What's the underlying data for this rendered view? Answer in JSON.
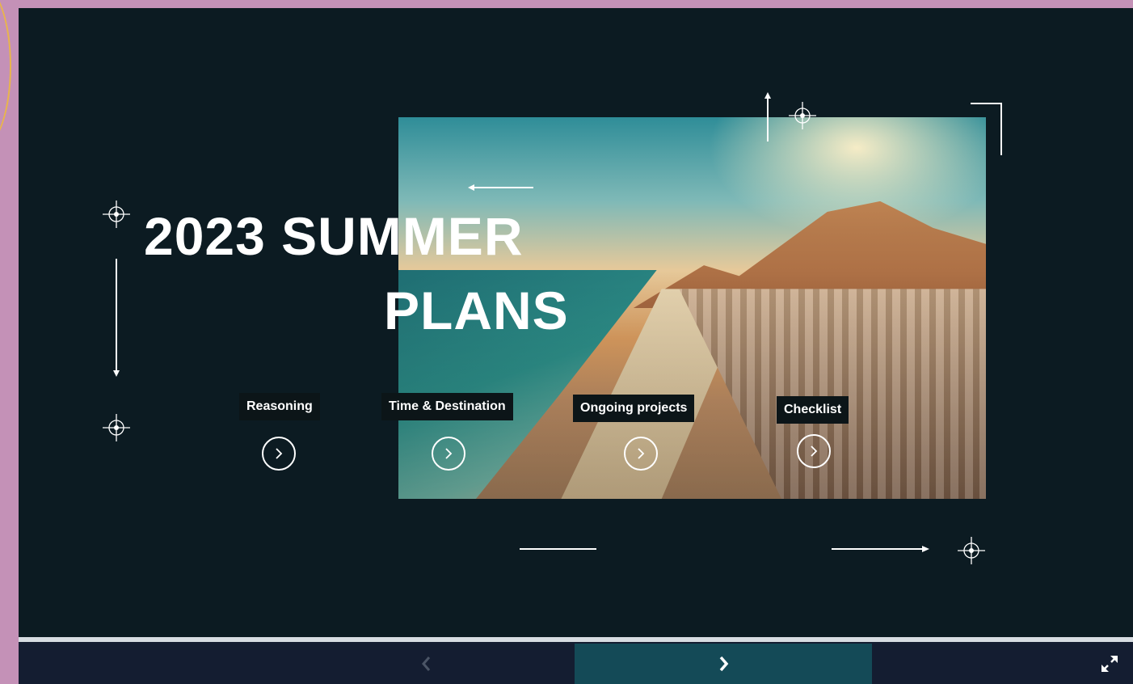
{
  "slide": {
    "title_line1": "2023 SUMMER",
    "title_line2": "PLANS",
    "nav_items": [
      {
        "label": "Reasoning"
      },
      {
        "label": "Time & Destination"
      },
      {
        "label": "Ongoing projects"
      },
      {
        "label": "Checklist"
      }
    ]
  },
  "controls": {
    "prev_icon": "chevron-left-icon",
    "next_icon": "chevron-right-icon",
    "fullscreen_icon": "expand-icon"
  },
  "colors": {
    "background": "#0c1b22",
    "frame": "#c491b7",
    "bottom_bar": "#141d31",
    "next_button": "#144a57",
    "text": "#ffffff"
  }
}
